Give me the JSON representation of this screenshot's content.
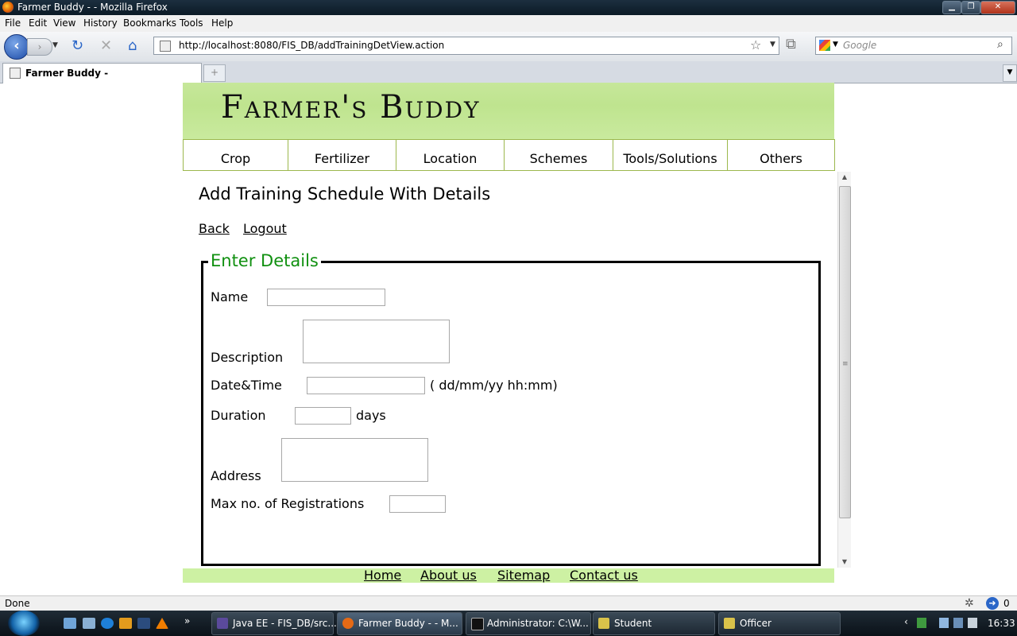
{
  "window": {
    "title": "Farmer Buddy - - Mozilla Firefox"
  },
  "menu": {
    "file": "File",
    "edit": "Edit",
    "view": "View",
    "history": "History",
    "bookmarks": "Bookmarks",
    "tools": "Tools",
    "help": "Help"
  },
  "toolbar": {
    "url": "http://localhost:8080/FIS_DB/addTrainingDetView.action",
    "search_placeholder": "Google"
  },
  "tabs": [
    {
      "title": "Farmer Buddy -"
    }
  ],
  "page": {
    "logo": "Farmer's Buddy",
    "nav": [
      "Crop",
      "Fertilizer",
      "Location",
      "Schemes",
      "Tools/Solutions",
      "Others"
    ],
    "heading": "Add Training Schedule With Details",
    "links": {
      "back": "Back",
      "logout": "Logout"
    },
    "form": {
      "legend": "Enter Details",
      "name_label": "Name",
      "description_label": "Description",
      "datetime_label": "Date&Time",
      "datetime_hint": "( dd/mm/yy hh:mm)",
      "duration_label": "Duration",
      "duration_unit": "days",
      "address_label": "Address",
      "maxreg_label": "Max no. of Registrations"
    },
    "footer": [
      "Home",
      "About us",
      "Sitemap",
      "Contact us"
    ]
  },
  "status": {
    "text": "Done",
    "count": "0"
  },
  "taskbar": {
    "buttons": [
      "Java EE - FIS_DB/src...",
      "Farmer Buddy - - M...",
      "Administrator: C:\\W...",
      "Student",
      "Officer"
    ],
    "clock": "16:33"
  }
}
